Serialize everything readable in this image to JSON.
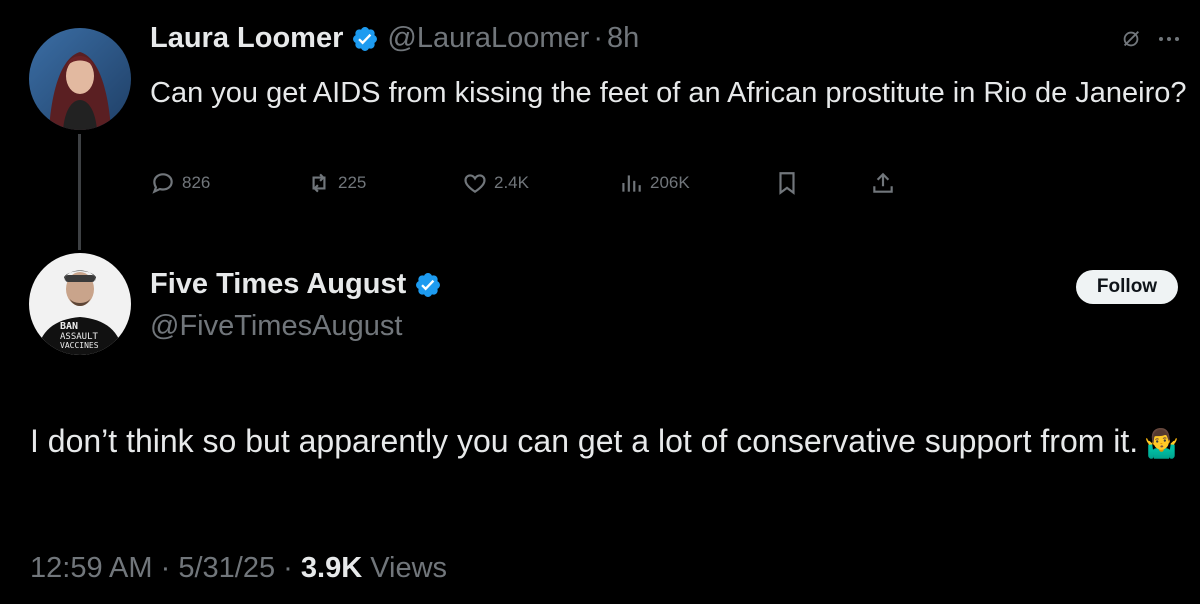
{
  "parent_tweet": {
    "author_name": "Laura Loomer",
    "handle": "@LauraLoomer",
    "separator": "·",
    "time": "8h",
    "text": "Can you get AIDS from kissing the feet of an African prostitute in Rio de Janeiro?",
    "stats": {
      "replies": "826",
      "reposts": "225",
      "likes": "2.4K",
      "views": "206K"
    },
    "icons": [
      "reply-icon",
      "repost-icon",
      "like-icon",
      "views-icon",
      "bookmark-icon",
      "share-icon",
      "grok-icon",
      "more-icon"
    ]
  },
  "reply_tweet": {
    "author_name": "Five Times August",
    "handle": "@FiveTimesAugust",
    "follow_label": "Follow",
    "text": "I don’t think so but apparently you can get a lot of conservative support from it.",
    "emoji": "🤷‍♂️",
    "time": "12:59 AM",
    "separator": "·",
    "date": "5/31/25",
    "views_count": "3.9K",
    "views_label": "Views",
    "avatar_shirt_text": [
      "BAN",
      "ASSAULT",
      "VACCINES"
    ]
  },
  "colors": {
    "background": "#000000",
    "text_primary": "#e7e9ea",
    "text_secondary": "#71767b",
    "verified_blue": "#1d9bf0",
    "thread_line": "#3e4144",
    "follow_bg": "#eff3f4"
  }
}
